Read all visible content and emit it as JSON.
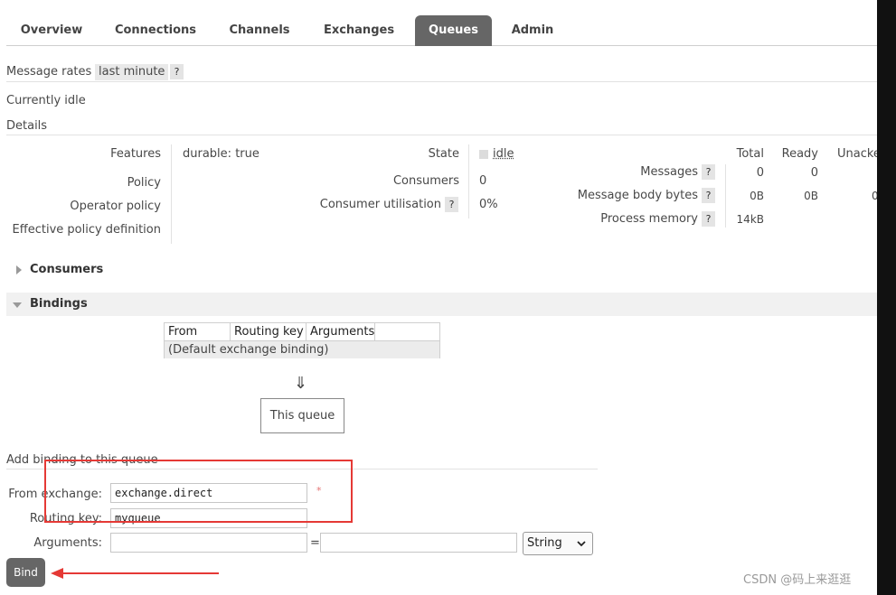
{
  "nav": {
    "tabs": [
      {
        "label": "Overview"
      },
      {
        "label": "Connections"
      },
      {
        "label": "Channels"
      },
      {
        "label": "Exchanges"
      },
      {
        "label": "Queues",
        "active": true
      },
      {
        "label": "Admin"
      }
    ]
  },
  "rates": {
    "label": "Message rates",
    "value": "last minute",
    "help": "?"
  },
  "status": "Currently idle",
  "details": {
    "title": "Details",
    "features_label": "Features",
    "durable_key": "durable:",
    "durable_value": "true",
    "policy_label": "Policy",
    "operator_policy_label": "Operator policy",
    "effective_policy_label": "Effective policy definition",
    "state_label": "State",
    "state_value": "idle",
    "consumers_label": "Consumers",
    "consumers_value": "0",
    "utilisation_label": "Consumer utilisation",
    "utilisation_value": "0%",
    "help": "?"
  },
  "stats": {
    "headers": [
      "Total",
      "Ready",
      "Unacke"
    ],
    "rows": [
      {
        "label": "Messages",
        "total": "0",
        "ready": "0",
        "unacked": ""
      },
      {
        "label": "Message body bytes",
        "total": "0B",
        "ready": "0B",
        "unacked": "0"
      },
      {
        "label": "Process memory",
        "total": "14kB",
        "ready": "",
        "unacked": ""
      }
    ]
  },
  "consumers_section": {
    "title": "Consumers",
    "expanded": false
  },
  "bindings_section": {
    "title": "Bindings",
    "expanded": true,
    "columns": [
      "From",
      "Routing key",
      "Arguments"
    ],
    "rows": [
      "(Default exchange binding)"
    ],
    "arrow": "⇓",
    "this_queue": "This queue"
  },
  "add_binding": {
    "title": "Add binding to this queue",
    "from_label": "From exchange:",
    "from_value": "exchange.direct",
    "required_mark": "*",
    "routing_label": "Routing key:",
    "routing_value": "myqueue",
    "arguments_label": "Arguments:",
    "equals": "=",
    "type_value": "String",
    "bind_label": "Bind"
  },
  "watermark": "CSDN @码上来逛逛",
  "colors": {
    "accent": "#666666",
    "annotation": "#e53935"
  }
}
